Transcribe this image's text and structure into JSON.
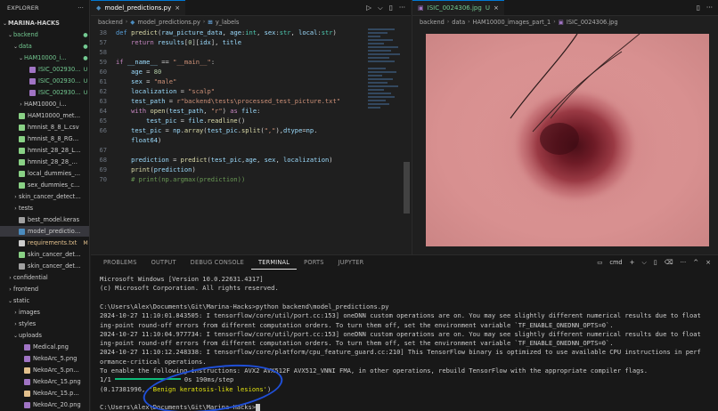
{
  "explorer": {
    "title": "EXPLORER",
    "more_icon": "ellipsis-icon",
    "items": [
      {
        "label": "MARINA-HACKS",
        "status": "",
        "color": "#cccccc"
      },
      {
        "label": "backend",
        "status": "●",
        "color": "#73c991"
      },
      {
        "label": "data",
        "status": "●",
        "color": "#73c991"
      },
      {
        "label": "HAM10000_i...",
        "status": "●",
        "color": "#73c991"
      },
      {
        "label": "ISIC_002930...",
        "status": "U",
        "color": "#73c991"
      },
      {
        "label": "ISIC_002930...",
        "status": "U",
        "color": "#73c991"
      },
      {
        "label": "ISIC_002930...",
        "status": "U",
        "color": "#73c991"
      },
      {
        "label": "HAM10000_i...",
        "status": "",
        "color": "#cccccc"
      },
      {
        "label": "HAM10000_metad...",
        "status": "",
        "color": "#cccccc"
      },
      {
        "label": "hmnist_8_8_L.csv",
        "status": "",
        "color": "#cccccc"
      },
      {
        "label": "hmnist_8_8_RGB.csv",
        "status": "",
        "color": "#cccccc"
      },
      {
        "label": "hmnist_28_28_L.csv",
        "status": "",
        "color": "#cccccc"
      },
      {
        "label": "hmnist_28_28_RGB...",
        "status": "",
        "color": "#cccccc"
      },
      {
        "label": "local_dummies_col...",
        "status": "",
        "color": "#cccccc"
      },
      {
        "label": "sex_dummies_colu...",
        "status": "",
        "color": "#cccccc"
      },
      {
        "label": "skin_cancer_detectio...",
        "status": "",
        "color": "#cccccc"
      },
      {
        "label": "tests",
        "status": "",
        "color": "#cccccc"
      },
      {
        "label": "best_model.keras",
        "status": "",
        "color": "#cccccc"
      },
      {
        "label": "model_predictions.py",
        "status": "",
        "color": "#cccccc"
      },
      {
        "label": "requirements.txt",
        "status": "M",
        "color": "#e2c08d"
      },
      {
        "label": "skin_cancer_detectio...",
        "status": "",
        "color": "#cccccc"
      },
      {
        "label": "skin_cancer_detectio...",
        "status": "",
        "color": "#cccccc"
      },
      {
        "label": "confidential",
        "status": "",
        "color": "#cccccc"
      },
      {
        "label": "frontend",
        "status": "",
        "color": "#cccccc"
      },
      {
        "label": "static",
        "status": "",
        "color": "#cccccc"
      },
      {
        "label": "images",
        "status": "",
        "color": "#cccccc"
      },
      {
        "label": "styles",
        "status": "",
        "color": "#cccccc"
      },
      {
        "label": "uploads",
        "status": "",
        "color": "#cccccc"
      },
      {
        "label": "Medical.png",
        "status": "",
        "color": "#cccccc"
      },
      {
        "label": "NekoArc_5.png",
        "status": "",
        "color": "#cccccc"
      },
      {
        "label": "NekoArc_5.png_m...",
        "status": "",
        "color": "#cccccc"
      },
      {
        "label": "NekoArc_15.png",
        "status": "",
        "color": "#cccccc"
      },
      {
        "label": "NekoArc_15.png_...",
        "status": "",
        "color": "#cccccc"
      },
      {
        "label": "NekoArc_20.png",
        "status": "",
        "color": "#cccccc"
      }
    ]
  },
  "editor1": {
    "tab_label": "model_predictions.py",
    "tab_close": "×",
    "actions": [
      "▷",
      "⌵",
      "▯",
      "···"
    ],
    "breadcrumb": [
      "backend",
      "model_predictions.py",
      "y_labels"
    ],
    "lines": [
      {
        "n": "38",
        "t": "def predict(raw_picture_data, age:int, sex:str, local:str)"
      },
      {
        "n": "57",
        "t": "    return results[0][idx], title"
      },
      {
        "n": "58",
        "t": ""
      },
      {
        "n": "59",
        "t": "if __name__ == \"__main__\":"
      },
      {
        "n": "60",
        "t": "    age = 80"
      },
      {
        "n": "61",
        "t": "    sex = \"male\""
      },
      {
        "n": "62",
        "t": "    localization = \"scalp\""
      },
      {
        "n": "63",
        "t": "    test_path = r\"backend\\tests\\processed_test_picture.txt\""
      },
      {
        "n": "64",
        "t": "    with open(test_path, \"r\") as file:"
      },
      {
        "n": "65",
        "t": "        test_pic = file.readline()"
      },
      {
        "n": "66",
        "t": "    test_pic = np.array(test_pic.split(\",\"),dtype=np."
      },
      {
        "n": "",
        "t": "    float64)"
      },
      {
        "n": "67",
        "t": ""
      },
      {
        "n": "68",
        "t": "    prediction = predict(test_pic,age, sex, localization)"
      },
      {
        "n": "69",
        "t": "    print(prediction)"
      },
      {
        "n": "70",
        "t": "    # print(np.argmax(prediction))"
      }
    ]
  },
  "editor2": {
    "tab_label": "ISIC_0024306.jpg",
    "tab_status": "U",
    "tab_close": "×",
    "actions": [
      "▯",
      "···"
    ],
    "breadcrumb": [
      "backend",
      "data",
      "HAM10000_images_part_1",
      "ISIC_0024306.jpg"
    ],
    "image_icon": "lesion-image"
  },
  "panel": {
    "tabs": [
      "PROBLEMS",
      "OUTPUT",
      "DEBUG CONSOLE",
      "TERMINAL",
      "PORTS",
      "JUPYTER"
    ],
    "active_tab": "TERMINAL",
    "shell": "cmd",
    "actions": [
      "+",
      "⌵",
      "▯",
      "🗑",
      "···",
      "^",
      "×"
    ],
    "terminal": [
      "Microsoft Windows [Version 10.0.22631.4317]",
      "(c) Microsoft Corporation. All rights reserved.",
      "",
      "C:\\Users\\Alex\\Documents\\Git\\Marina-Hacks>python backend\\model_predictions.py",
      "2024-10-27 11:10:01.843505: I tensorflow/core/util/port.cc:153] oneDNN custom operations are on. You may see slightly different numerical results due to float",
      "ing-point round-off errors from different computation orders. To turn them off, set the environment variable `TF_ENABLE_ONEDNN_OPTS=0`.",
      "2024-10-27 11:10:04.977734: I tensorflow/core/util/port.cc:153] oneDNN custom operations are on. You may see slightly different numerical results due to float",
      "ing-point round-off errors from different computation orders. To turn them off, set the environment variable `TF_ENABLE_ONEDNN_OPTS=0`.",
      "2024-10-27 11:10:12.248338: I tensorflow/core/platform/cpu_feature_guard.cc:210] This TensorFlow binary is optimized to use available CPU instructions in perf",
      "ormance-critical operations.",
      "To enable the following instructions: AVX2 AVX512F AVX512_VNNI FMA, in other operations, rebuild TensorFlow with the appropriate compiler flags."
    ],
    "progress_prefix": "1/1",
    "progress_suffix": "0s 190ms/step",
    "result_prefix": "(0.17381996, ",
    "result_label": "'Benign keratosis-like lesions'",
    "result_suffix": ")",
    "prompt": "C:\\Users\\Alex\\Documents\\Git\\Marina-Hacks>"
  }
}
